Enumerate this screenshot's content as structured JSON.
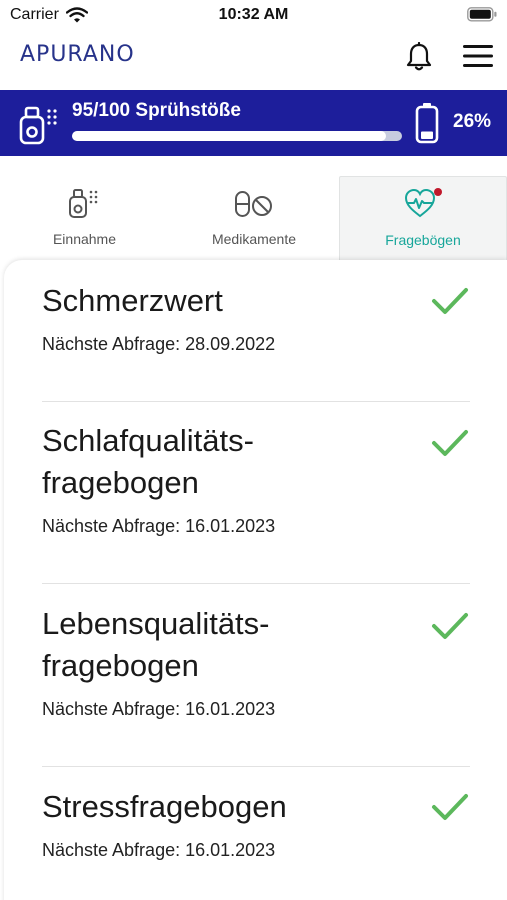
{
  "status_bar": {
    "carrier": "Carrier",
    "time": "10:32 AM"
  },
  "header": {
    "logo": "APURANO"
  },
  "device": {
    "puffs_label": "95/100 Sprühstöße",
    "puffs_remaining_fraction": 0.95,
    "battery_label": "26%",
    "battery_fraction": 0.26
  },
  "tabs": [
    {
      "label": "Einnahme",
      "icon": "inhaler-icon",
      "active": false
    },
    {
      "label": "Medikamente",
      "icon": "pill-icon",
      "active": false
    },
    {
      "label": "Fragebögen",
      "icon": "heart-pulse-icon",
      "active": true,
      "notification_dot": true
    }
  ],
  "questionnaires": [
    {
      "title": "Schmerzwert",
      "next": "Nächste Abfrage: 28.09.2022",
      "done": true
    },
    {
      "title_line1": "Schlafqualitäts-",
      "title_line2": "fragebogen",
      "next": "Nächste Abfrage: 16.01.2023",
      "done": true
    },
    {
      "title_line1": "Lebensqualitäts-",
      "title_line2": "fragebogen",
      "next": "Nächste Abfrage: 16.01.2023",
      "done": true
    },
    {
      "title": "Stressfragebogen",
      "next": "Nächste Abfrage: 16.01.2023",
      "done": true
    }
  ],
  "colors": {
    "brand_blue": "#1d1e9b",
    "accent_teal": "#17a69a",
    "check_green": "#5cb85c",
    "notification_red": "#c0182b"
  }
}
